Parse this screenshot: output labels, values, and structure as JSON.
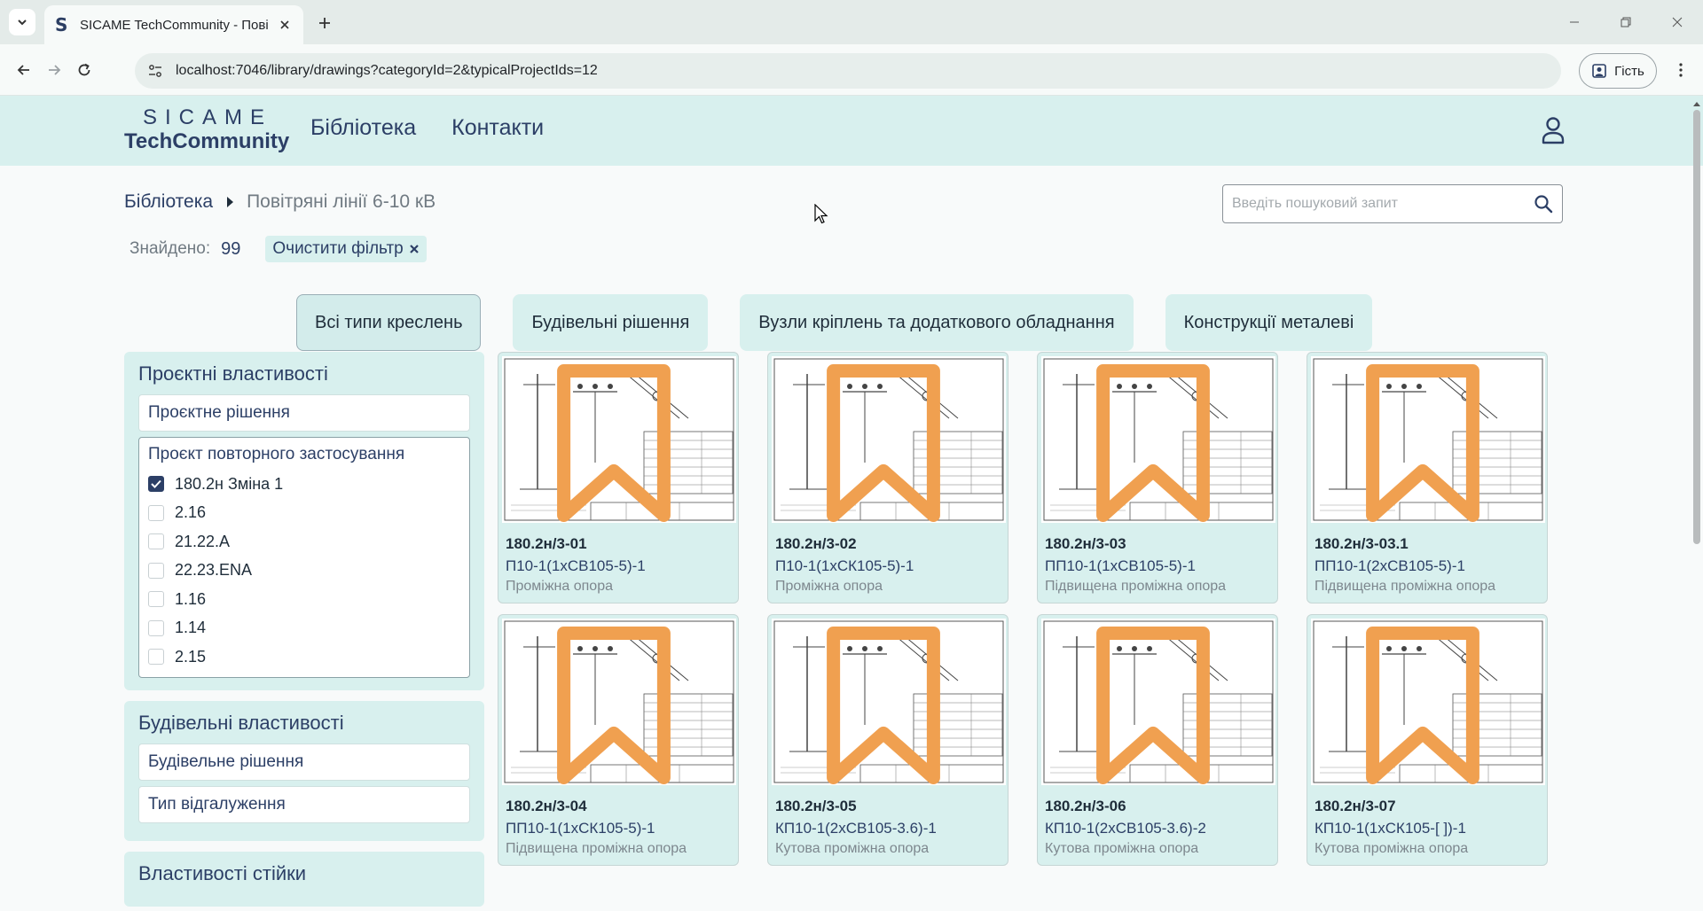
{
  "browser": {
    "tab_title": "SICAME TechCommunity - Пові",
    "url": "localhost:7046/library/drawings?categoryId=2&typicalProjectIds=12",
    "profile_label": "Гість",
    "favicon_letter": "S"
  },
  "header": {
    "logo_top": "SICAME",
    "logo_bottom": "TechCommunity",
    "nav": [
      "Бібліотека",
      "Контакти"
    ]
  },
  "breadcrumb": {
    "home": "Бібліотека",
    "current": "Повітряні лінії 6-10 кВ"
  },
  "search": {
    "placeholder": "Введіть пошуковий запит"
  },
  "results": {
    "found_label": "Знайдено:",
    "found_count": "99",
    "clear_filter_label": "Очистити фільтр"
  },
  "type_tabs": [
    {
      "label": "Всі типи креслень",
      "active": true
    },
    {
      "label": "Будівельні рішення",
      "active": false
    },
    {
      "label": "Вузли кріплень та додаткового обладнання",
      "active": false
    },
    {
      "label": "Конструкції металеві",
      "active": false
    }
  ],
  "sidebar": {
    "project_props": {
      "title": "Проєктні властивості",
      "field_solution": "Проєктне рішення",
      "reuse_title": "Проєкт повторного застосування",
      "items": [
        {
          "label": "180.2н Зміна 1",
          "checked": true
        },
        {
          "label": "2.16",
          "checked": false
        },
        {
          "label": "21.22.А",
          "checked": false
        },
        {
          "label": "22.23.ENA",
          "checked": false
        },
        {
          "label": "1.16",
          "checked": false
        },
        {
          "label": "1.14",
          "checked": false
        },
        {
          "label": "2.15",
          "checked": false
        }
      ]
    },
    "building_props": {
      "title": "Будівельні властивості",
      "field_solution": "Будівельне рішення",
      "field_branch": "Тип відгалуження"
    },
    "pole_props": {
      "title": "Властивості стійки"
    }
  },
  "cards": [
    {
      "code": "180.2н/3-01",
      "name": "П10-1(1хСВ105-5)-1",
      "type": "Проміжна опора"
    },
    {
      "code": "180.2н/3-02",
      "name": "П10-1(1хСК105-5)-1",
      "type": "Проміжна опора"
    },
    {
      "code": "180.2н/3-03",
      "name": "ПП10-1(1хСВ105-5)-1",
      "type": "Підвищена проміжна опора"
    },
    {
      "code": "180.2н/3-03.1",
      "name": "ПП10-1(2хСВ105-5)-1",
      "type": "Підвищена проміжна опора"
    },
    {
      "code": "180.2н/3-04",
      "name": "ПП10-1(1хСК105-5)-1",
      "type": "Підвищена проміжна опора"
    },
    {
      "code": "180.2н/3-05",
      "name": "КП10-1(2хСВ105-3.6)-1",
      "type": "Кутова проміжна опора"
    },
    {
      "code": "180.2н/3-06",
      "name": "КП10-1(2хСВ105-3.6)-2",
      "type": "Кутова проміжна опора"
    },
    {
      "code": "180.2н/3-07",
      "name": "КП10-1(1хСК105-[ ])-1",
      "type": "Кутова проміжна опора"
    }
  ],
  "colors": {
    "brand": "#2c3f66",
    "accent_bg": "#d8f0ee",
    "bookmark": "#f0a050"
  }
}
